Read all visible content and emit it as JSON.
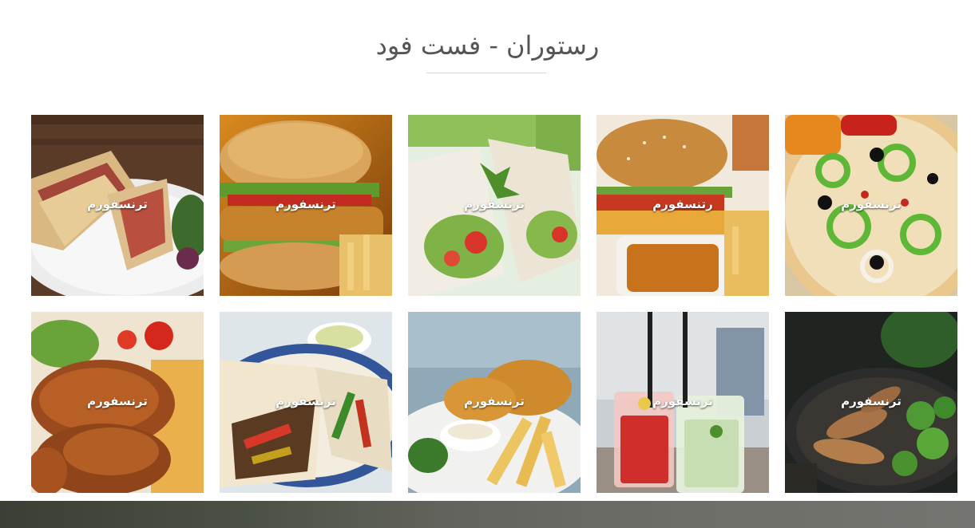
{
  "section": {
    "title": "رستوران - فست فود"
  },
  "gallery": {
    "items": [
      {
        "label": "ترنسفورم",
        "food": "panini-sandwich"
      },
      {
        "label": "ترنسفورم",
        "food": "chicken-burger"
      },
      {
        "label": "ترنسفورم",
        "food": "wrap-rolls"
      },
      {
        "label": "رتنسفورم",
        "food": "burger-fries"
      },
      {
        "label": "ترنسفورم",
        "food": "pizza"
      },
      {
        "label": "ترنسفورم",
        "food": "roast-chicken"
      },
      {
        "label": "ترنسفورم",
        "food": "fajita-wrap"
      },
      {
        "label": "ترنسفورم",
        "food": "fried-chicken-fries"
      },
      {
        "label": "ترنسفورم",
        "food": "cocktail-drinks"
      },
      {
        "label": "ترنسفورم",
        "food": "chicken-broccoli-pan"
      }
    ]
  }
}
